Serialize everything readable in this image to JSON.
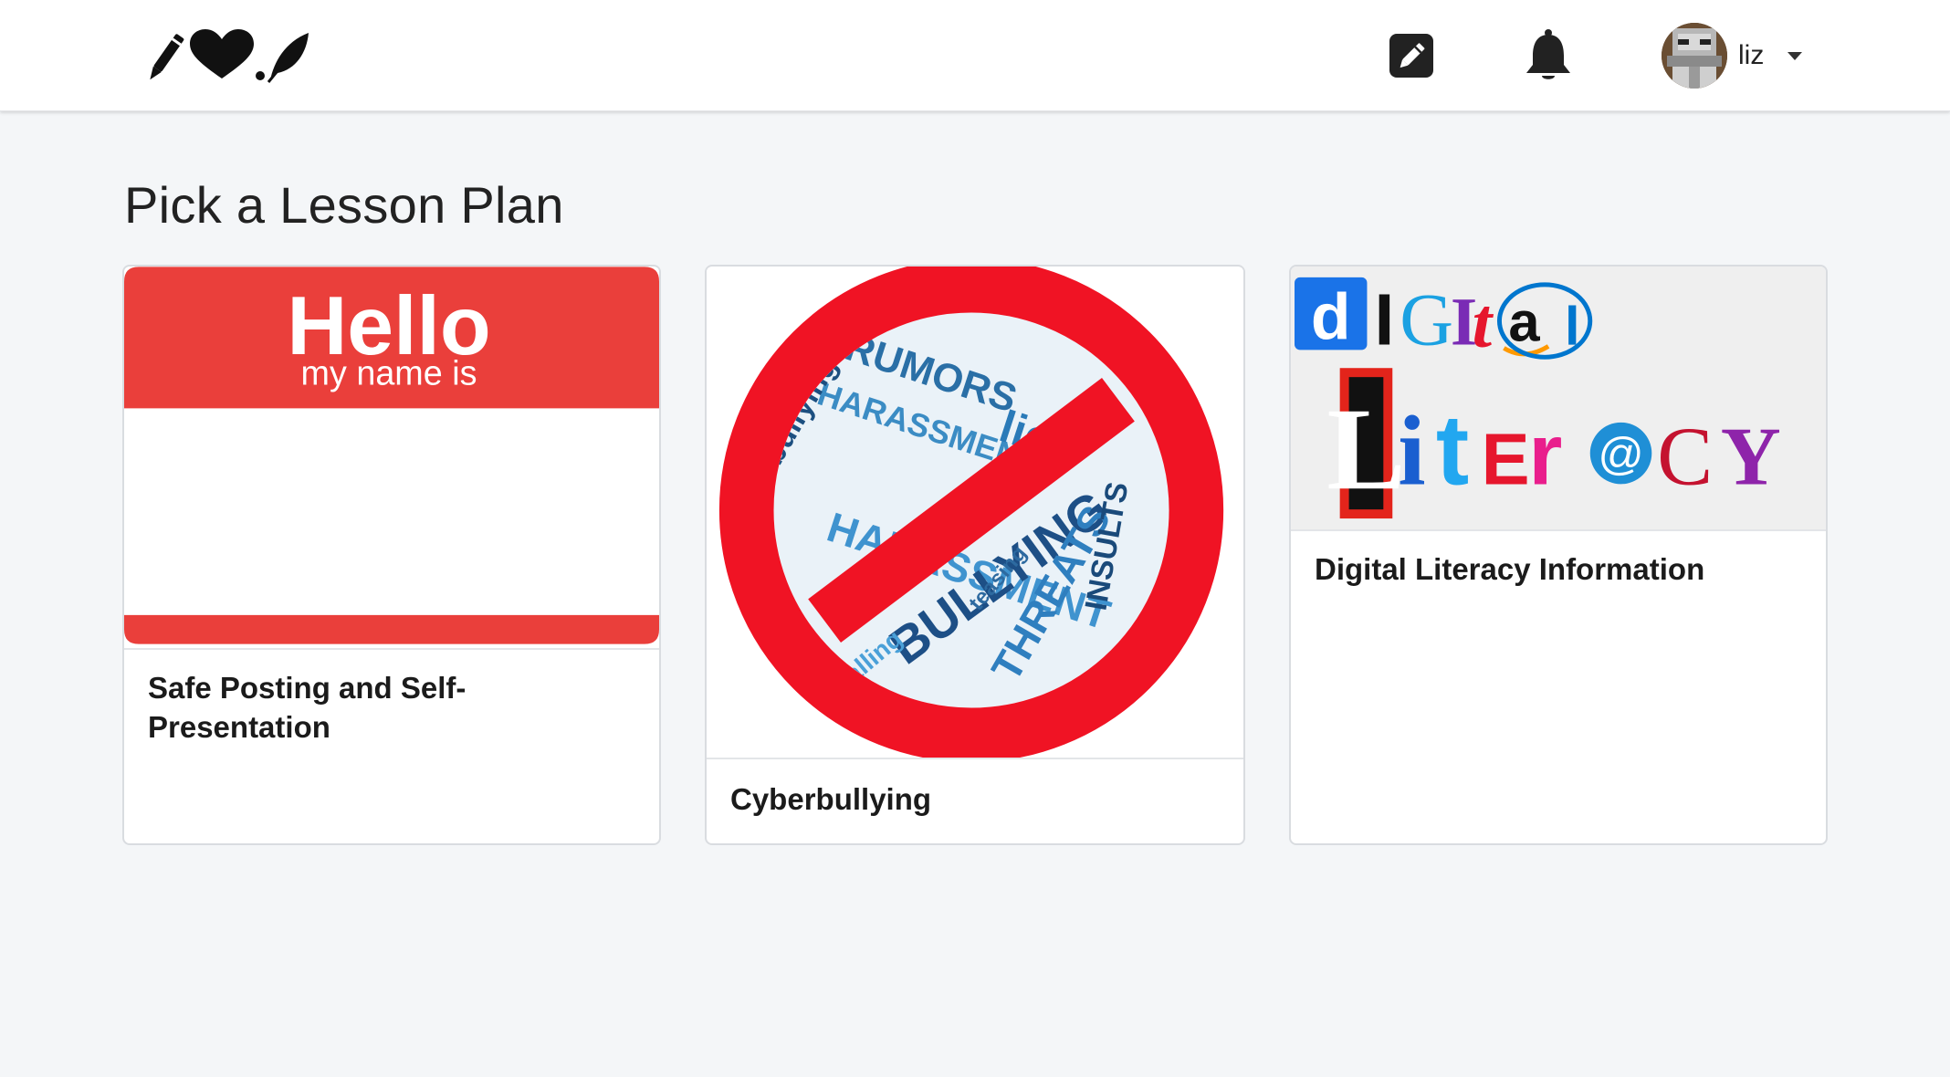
{
  "nav": {
    "logo_icon": "pencil-heart-dot-leaf-logo",
    "compose_icon": "pencil-square-icon",
    "notifications_icon": "bell-icon",
    "user": {
      "name": "liz",
      "avatar_icon": "pixel-avatar",
      "menu_icon": "caret-down-icon"
    }
  },
  "page": {
    "title": "Pick a Lesson Plan"
  },
  "lessons": [
    {
      "title": "Safe Posting and Self-Presentation",
      "image_text": {
        "line1": "Hello",
        "line2": "my name is"
      }
    },
    {
      "title": "Cyberbullying",
      "image_words": [
        "RUMORS",
        "HARASSMENT",
        "bullying",
        "lies",
        "BULLYING",
        "THREATS",
        "INSULTS",
        "calling",
        "teasing"
      ]
    },
    {
      "title": "Digital Literacy Information",
      "image_words": [
        "d",
        "I",
        "G",
        "I",
        "t",
        "a",
        "l",
        "L",
        "i",
        "t",
        "E",
        "r",
        "@",
        "C",
        "Y"
      ]
    }
  ],
  "colors": {
    "accent_red": "#ea3f3b",
    "stop_red": "#f01324",
    "word_blue": "#1f6fa8",
    "background": "#f4f6f8"
  }
}
